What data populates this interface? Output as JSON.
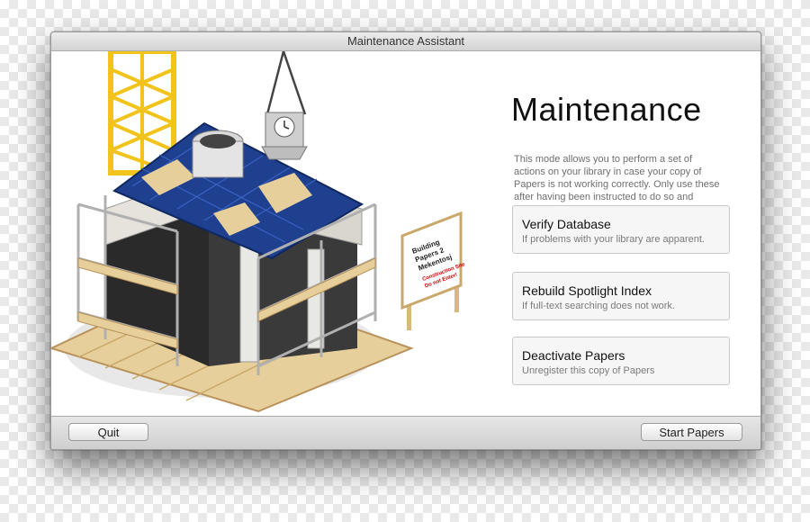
{
  "window": {
    "title": "Maintenance Assistant"
  },
  "illustration": {
    "sign_lines": [
      "Building",
      "Papers 2",
      "Mekentosj"
    ],
    "sign_warning_lines": [
      "Construction Site",
      "Do not Enter!"
    ]
  },
  "main": {
    "heading": "Maintenance",
    "description": "This mode allows you to perform a set of actions on your library in case your copy of Papers is not working correctly. Only use these after having been instructed to do so and always make a backup first.",
    "options": [
      {
        "title": "Verify Database",
        "subtitle": "If problems with your library are apparent."
      },
      {
        "title": "Rebuild Spotlight Index",
        "subtitle": "If full-text searching does not work."
      },
      {
        "title": "Deactivate Papers",
        "subtitle": "Unregister this copy of Papers"
      }
    ]
  },
  "footer": {
    "quit_label": "Quit",
    "start_label": "Start Papers"
  },
  "colors": {
    "roof": "#1f3f8f",
    "crane": "#f2c31a",
    "wood": "#e6cf9a",
    "wall": "#2a2a2a"
  }
}
